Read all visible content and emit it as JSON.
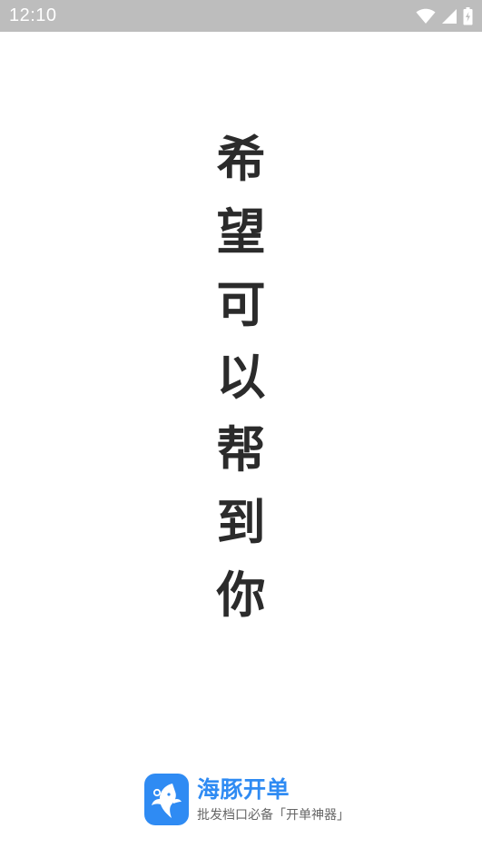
{
  "status_bar": {
    "time": "12:10",
    "icons": [
      "wifi-icon",
      "cell-signal-icon",
      "battery-charging-icon"
    ]
  },
  "slogan": {
    "chars": [
      "希",
      "望",
      "可",
      "以",
      "帮",
      "到",
      "你"
    ]
  },
  "brand": {
    "name": "海豚开单",
    "tagline": "批发档口必备「开单神器」",
    "icon": "dolphin-logo-icon",
    "accent_color": "#2f8bf3",
    "highlight_color": "#ffd84a"
  }
}
